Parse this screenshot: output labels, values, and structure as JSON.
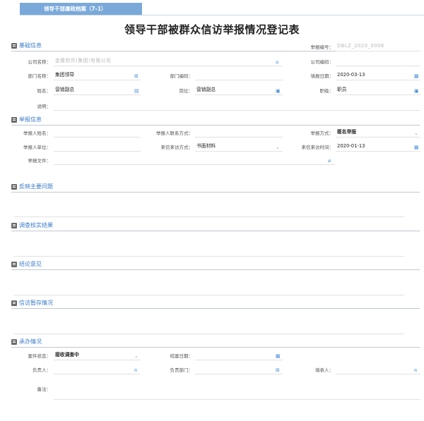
{
  "tab": {
    "label": "领导干部廉政档案（7-1）"
  },
  "title": "领导干部被群众信访举报情况登记表",
  "basic": {
    "section": "基础信息",
    "report_no_label": "举报编号：",
    "report_no_value": "DBLZ_2020_0006",
    "company_name_label": "公司名称：",
    "company_name_value": "金蝶软件(集团)有限公司",
    "company_code_label": "公司编码：",
    "dept_name_label": "部门名称：",
    "dept_name_value": "集团领导",
    "dept_code_label": "部门编码：",
    "fill_date_label": "填报日期：",
    "fill_date_value": "2020-03-13",
    "name_label": "姓名：",
    "name_value": "营销副总",
    "post_label": "岗位：",
    "post_value": "营销副总",
    "rank_label": "职级：",
    "rank_value": "职员",
    "note_label": "说明："
  },
  "report": {
    "section": "举报信息",
    "reporter_name_label": "举报人姓名：",
    "reporter_contact_label": "举报人联系方式：",
    "method_label": "举报方式：",
    "method_value": "匿名举报",
    "reporter_unit_label": "举报人单位：",
    "visit_method_label": "来信来访方式：",
    "visit_method_value": "书面材料",
    "visit_time_label": "来信来访时间：",
    "visit_time_value": "2020-01-13",
    "file_label": "举报文件："
  },
  "issues": {
    "section": "反映主要问题"
  },
  "verify": {
    "section": "调查核实结果"
  },
  "conclusion": {
    "section": "结论意见"
  },
  "pending": {
    "section": "信访暂存情况"
  },
  "handling": {
    "section": "承办情况",
    "status_label": "案件状态：",
    "status_value": "接收调查中",
    "close_date_label": "结案日期：",
    "owner_label": "负责人：",
    "owner_dept_label": "负责部门：",
    "filler_label": "填表人：",
    "remark_label": "备注："
  },
  "icons": {
    "home": "home-icon",
    "org": "org-chart-icon",
    "calendar": "calendar-icon",
    "list": "list-icon",
    "select": "select-box-icon",
    "chevron": "chevron-down-icon",
    "attach": "paperclip-icon",
    "user": "user-icon"
  },
  "colors": {
    "tab": "#7aa9d9",
    "section_label": "#3a7cc8",
    "icon": "#4a8fd6"
  }
}
